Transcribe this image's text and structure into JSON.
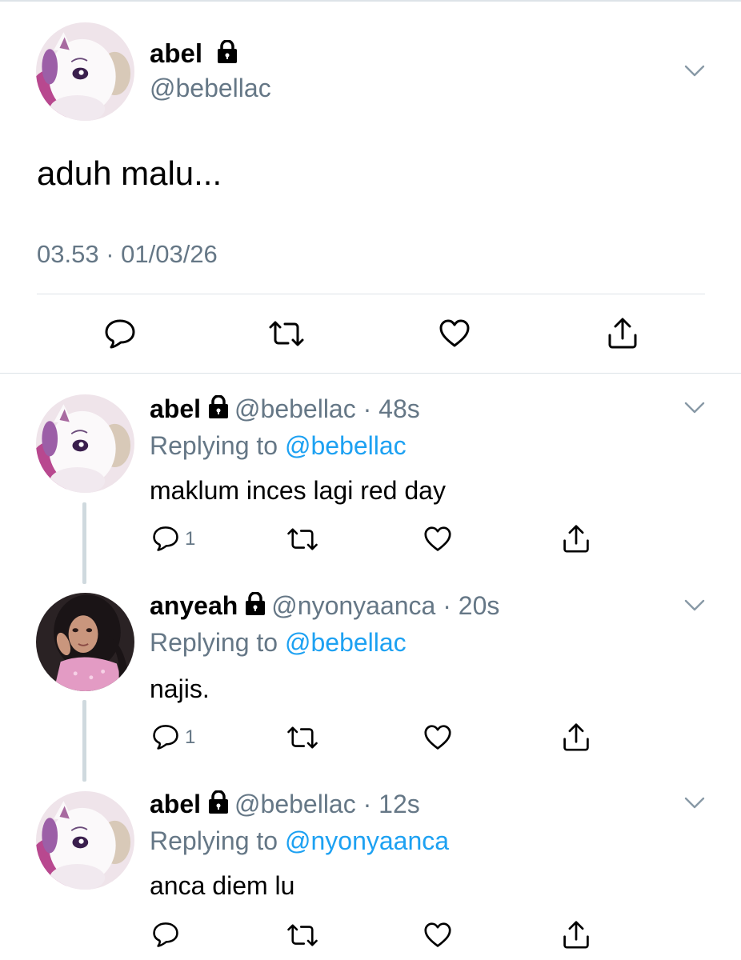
{
  "colors": {
    "text": "#000000",
    "muted": "#657786",
    "link": "#1da1f2",
    "divider": "#dde3e8",
    "thread_line": "#cfd9de"
  },
  "main_tweet": {
    "display_name": "abel",
    "handle": "@bebellac",
    "text": "aduh malu...",
    "timestamp": "03.53 · 01/03/26",
    "avatar": "white-cat-plush-avatar",
    "protected_icon": "lock-icon",
    "menu_icon": "chevron-down-icon",
    "actions": [
      "reply-icon",
      "retweet-icon",
      "like-icon",
      "share-icon"
    ]
  },
  "replies": [
    {
      "display_name": "abel",
      "handle": "@bebellac",
      "time": "48s",
      "replying_prefix": "Replying to",
      "replying_to": "@bebellac",
      "text": "maklum inces lagi red day",
      "reply_count": "1",
      "avatar": "white-cat-plush-avatar"
    },
    {
      "display_name": "anyeah",
      "handle": "@nyonyaanca",
      "time": "20s",
      "replying_prefix": "Replying to",
      "replying_to": "@bebellac",
      "text": "najis.",
      "reply_count": "1",
      "avatar": "girl-photo-avatar"
    },
    {
      "display_name": "abel",
      "handle": "@bebellac",
      "time": "12s",
      "replying_prefix": "Replying to",
      "replying_to": "@nyonyaanca",
      "text": "anca diem lu",
      "reply_count": "",
      "avatar": "white-cat-plush-avatar"
    }
  ]
}
